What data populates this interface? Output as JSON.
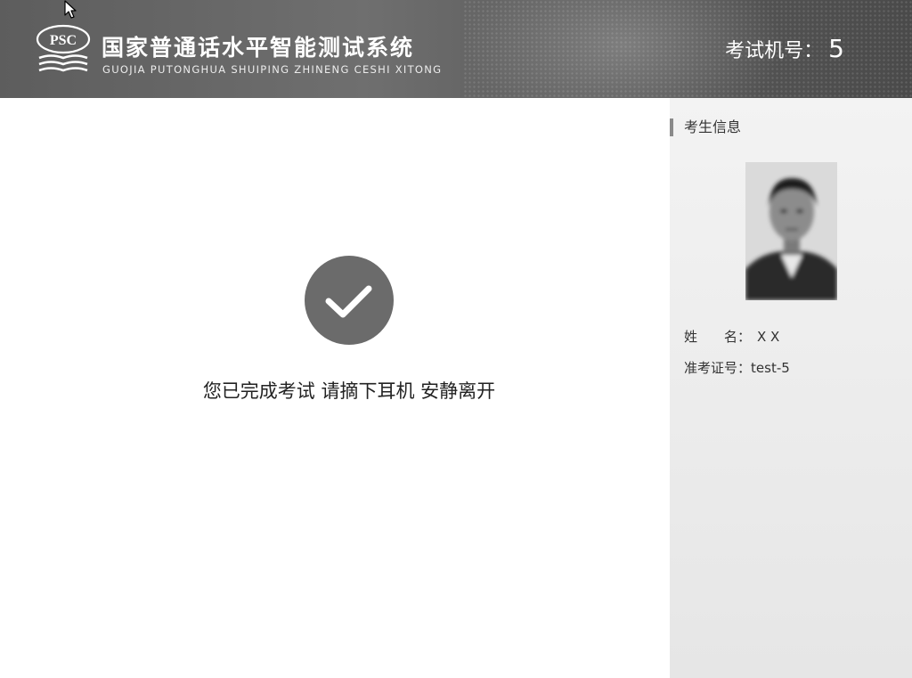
{
  "header": {
    "logo_text": "PSC",
    "title_cn": "国家普通话水平智能测试系统",
    "title_en": "GUOJIA PUTONGHUA SHUIPING ZHINENG CESHI XITONG",
    "machine_label": "考试机号：",
    "machine_number": "5"
  },
  "main": {
    "status_icon": "check-icon",
    "message": "您已完成考试 请摘下耳机 安静离开"
  },
  "sidebar": {
    "title": "考生信息",
    "photo": "candidate-photo",
    "name_label": "姓　　名：",
    "name_value": "X X",
    "id_label": "准考证号：",
    "id_value": "test-5"
  },
  "colors": {
    "header_bg": "#666666",
    "check_circle": "#6b6b6b",
    "sidebar_bg": "#ececec"
  }
}
